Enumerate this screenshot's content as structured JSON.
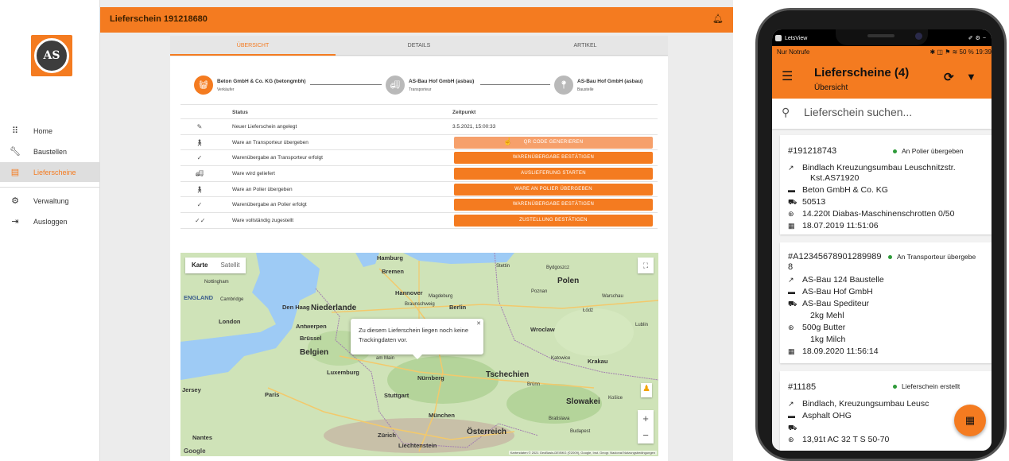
{
  "app": {
    "topbar_title": "Lieferschein 191218680",
    "sidebar": {
      "items": [
        {
          "label": "Home",
          "icon": "grid-icon"
        },
        {
          "label": "Baustellen",
          "icon": "wrench-icon"
        },
        {
          "label": "Lieferscheine",
          "icon": "list-icon",
          "active": true
        },
        {
          "label": "Verwaltung",
          "icon": "gear-icon"
        },
        {
          "label": "Ausloggen",
          "icon": "logout-icon"
        }
      ]
    },
    "tabs": [
      "ÜBERSICHT",
      "DETAILS",
      "ARTIKEL"
    ],
    "active_tab": "ÜBERSICHT",
    "parties": [
      {
        "name": "Beton GmbH & Co. KG (betongmbh)",
        "role": "Verkäufer"
      },
      {
        "name": "AS-Bau Hof GmbH (asbau)",
        "role": "Transporteur"
      },
      {
        "name": "AS-Bau Hof GmbH (asbau)",
        "role": "Baustelle"
      }
    ],
    "status_table": {
      "headers": [
        "Status",
        "Zeitpunkt"
      ],
      "rows": [
        {
          "status": "Neuer Lieferschein angelegt",
          "time": "3.5.2021, 15:00:33",
          "icon": "pencil-icon"
        },
        {
          "status": "Ware an Transporteur übergeben",
          "button": "QR CODE GENERIEREN",
          "icon": "handover-icon"
        },
        {
          "status": "Warenübergabe an Transporteur erfolgt",
          "button": "WARENÜBERGABE BESTÄTIGEN",
          "icon": "check-icon"
        },
        {
          "status": "Ware wird geliefert",
          "button": "AUSLIEFERUNG STARTEN",
          "icon": "truck-icon"
        },
        {
          "status": "Ware an Polier übergeben",
          "button": "WARE AN POLIER ÜBERGEBEN",
          "icon": "handover-icon"
        },
        {
          "status": "Warenübergabe an Polier erfolgt",
          "button": "WARENÜBERGABE BESTÄTIGEN",
          "icon": "check-icon"
        },
        {
          "status": "Ware vollständig zugestellt",
          "button": "ZUSTELLUNG BESTÄTIGEN",
          "icon": "double-check-icon"
        }
      ]
    },
    "map": {
      "type_buttons": [
        "Karte",
        "Satellit"
      ],
      "info_text": "Zu diesem Lieferschein liegen noch keine Trackingdaten vor.",
      "google": "Google",
      "attribution": "Kartendaten © 2021 GeoBasis-DE/BKG (©2009), Google, Inst. Geogr. Nacional   Nutzungsbedingungen",
      "labels": {
        "hamburg": "Hamburg",
        "bremen": "Bremen",
        "stettin": "Stettin",
        "bydgoszcz": "Bydgoszcz",
        "polen": "Polen",
        "poznan": "Poznan",
        "warschau": "Warschau",
        "hannover": "Hannover",
        "braunschweig": "Braunschweig",
        "magdeburg": "Magdeburg",
        "berlin": "Berlin",
        "niederlande": "Niederlande",
        "denhaag": "Den Haag",
        "england": "ENGLAND",
        "cambridge": "Cambridge",
        "nottingham": "Nottingham",
        "london": "London",
        "antwerpen": "Antwerpen",
        "brussel": "Brüssel",
        "belgien": "Belgien",
        "wroclaw": "Wroclaw",
        "lodz": "Łódź",
        "lublin": "Lublin",
        "katowice": "Katowice",
        "krakau": "Krakau",
        "luxemburg": "Luxemburg",
        "nurnberg": "Nürnberg",
        "tschechien": "Tschechien",
        "brunn": "Brünn",
        "jersey": "Jersey",
        "paris": "Paris",
        "stuttgart": "Stuttgart",
        "munchen": "München",
        "slowakei": "Slowakei",
        "kosice": "Košice",
        "bratislava": "Bratislava",
        "osterreich": "Österreich",
        "zurich": "Zürich",
        "nantes": "Nantes",
        "liechtenstein": "Liechtenstein",
        "budapest": "Budapest",
        "ammain": "am Main"
      }
    }
  },
  "phone": {
    "letsview": "LetsView",
    "statusbar_left": "Nur Notrufe",
    "statusbar_right": "50 % 19:39",
    "title": "Lieferscheine (4)",
    "subtitle": "Übersicht",
    "search_placeholder": "Lieferschein suchen...",
    "cards": [
      {
        "id": "#191218743",
        "status": "An Polier übergeben",
        "lines": [
          {
            "icon": "site-icon",
            "text": "Bindlach Kreuzungsumbau Leuschnitzstr."
          },
          {
            "icon": "",
            "text": "Kst.AS71920"
          },
          {
            "icon": "building-icon",
            "text": "Beton GmbH & Co. KG"
          },
          {
            "icon": "truck-icon",
            "text": "50513"
          },
          {
            "icon": "package-icon",
            "text": "14.220t Diabas-Maschinenschrotten 0/50"
          },
          {
            "icon": "calendar-icon",
            "text": "18.07.2019 11:51:06"
          }
        ]
      },
      {
        "id": "#A12345678901289989",
        "id_cont": "8",
        "status": "An Transporteur übergebe",
        "lines": [
          {
            "icon": "site-icon",
            "text": "AS-Bau 124 Baustelle"
          },
          {
            "icon": "building-icon",
            "text": "AS-Bau Hof GmbH"
          },
          {
            "icon": "truck-icon",
            "text": "AS-Bau Spediteur"
          },
          {
            "icon": "",
            "text": "2kg Mehl"
          },
          {
            "icon": "package-icon",
            "text": "500g Butter"
          },
          {
            "icon": "",
            "text": "1kg Milch"
          },
          {
            "icon": "calendar-icon",
            "text": "18.09.2020 11:56:14"
          }
        ]
      },
      {
        "id": "#11185",
        "status": "Lieferschein erstellt",
        "lines": [
          {
            "icon": "site-icon",
            "text": "Bindlach, Kreuzungsumbau Leusc"
          },
          {
            "icon": "building-icon",
            "text": "Asphalt OHG"
          },
          {
            "icon": "truck-icon",
            "text": ""
          },
          {
            "icon": "package-icon",
            "text": "13,91t AC 32 T S 50-70"
          }
        ]
      }
    ]
  },
  "colors": {
    "accent": "#f47b20",
    "status_green": "#2e9a3a"
  }
}
